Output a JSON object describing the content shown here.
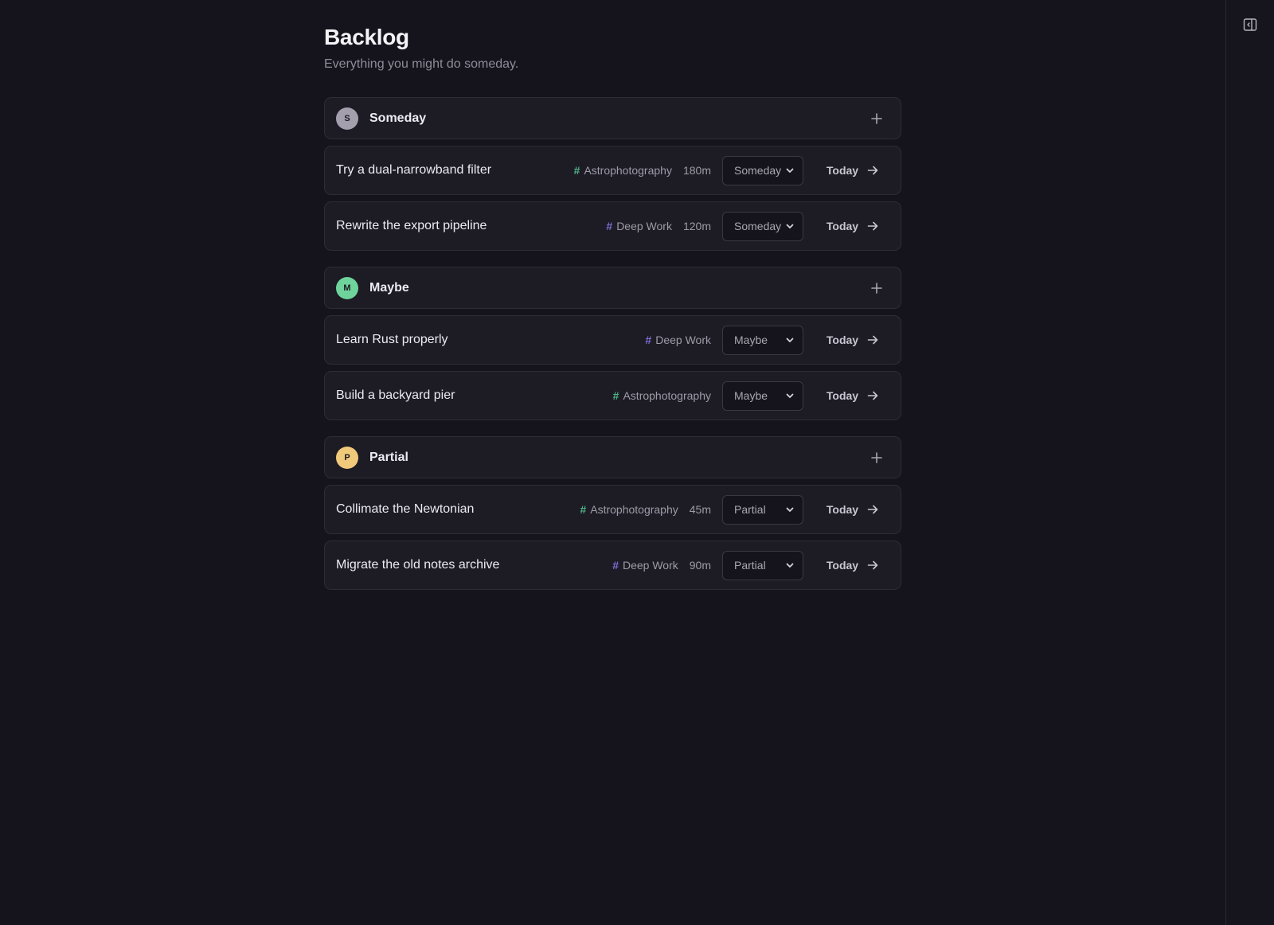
{
  "page": {
    "title": "Backlog",
    "subtitle": "Everything you might do someday."
  },
  "colors": {
    "background": "#15141d",
    "card": "#1d1c25",
    "border": "#2e2c37",
    "tag_astrophotography": "#4fb487",
    "tag_deep_work": "#7d6fd6"
  },
  "groups": [
    {
      "name": "Someday",
      "avatar_letter": "S",
      "avatar_color": "#a39fad",
      "add_icon": "plus-icon",
      "tasks": [
        {
          "title": "Try a dual-narrowband filter",
          "tag": "Astrophotography",
          "tag_color": "#4fb487",
          "duration": "180m",
          "status": "Someday",
          "action": "Today"
        },
        {
          "title": "Rewrite the export pipeline",
          "tag": "Deep Work",
          "tag_color": "#7d6fd6",
          "duration": "120m",
          "status": "Someday",
          "action": "Today"
        }
      ]
    },
    {
      "name": "Maybe",
      "avatar_letter": "M",
      "avatar_color": "#6fd49b",
      "add_icon": "plus-icon",
      "tasks": [
        {
          "title": "Learn Rust properly",
          "tag": "Deep Work",
          "tag_color": "#7d6fd6",
          "duration": "",
          "status": "Maybe",
          "action": "Today"
        },
        {
          "title": "Build a backyard pier",
          "tag": "Astrophotography",
          "tag_color": "#4fb487",
          "duration": "",
          "status": "Maybe",
          "action": "Today"
        }
      ]
    },
    {
      "name": "Partial",
      "avatar_letter": "P",
      "avatar_color": "#f1c97a",
      "add_icon": "plus-icon",
      "tasks": [
        {
          "title": "Collimate the Newtonian",
          "tag": "Astrophotography",
          "tag_color": "#4fb487",
          "duration": "45m",
          "status": "Partial",
          "action": "Today"
        },
        {
          "title": "Migrate the old notes archive",
          "tag": "Deep Work",
          "tag_color": "#7d6fd6",
          "duration": "90m",
          "status": "Partial",
          "action": "Today"
        }
      ]
    }
  ],
  "rail": {
    "toggle_icon": "sidebar-toggle-icon"
  }
}
